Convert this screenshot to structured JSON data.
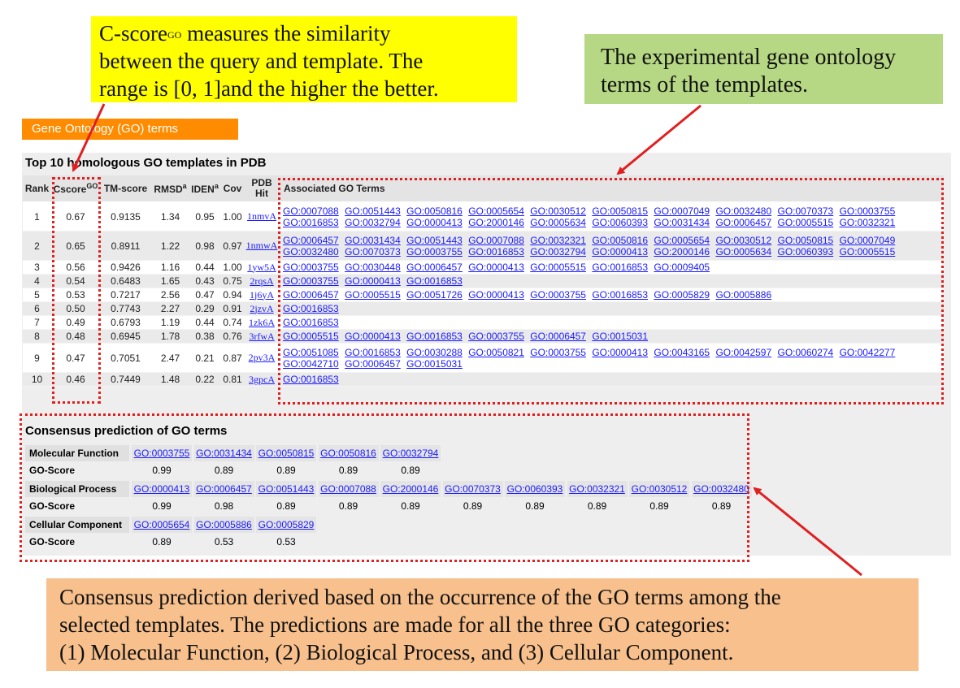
{
  "notes": {
    "cscore_line1_a": "C-score",
    "cscore_sup": "GO",
    "cscore_line1_b": " measures the similarity",
    "cscore_line2": "between the query and template. The",
    "cscore_line3": "range is [0, 1]and the  higher the better.",
    "experimental_line1": "The experimental gene ontology",
    "experimental_line2": "terms of the templates.",
    "consensus_line1": "Consensus prediction derived based on the occurrence of the GO terms  among the",
    "consensus_line2": "selected templates. The predictions are made for all the three GO categories:",
    "consensus_line3": "(1) Molecular Function, (2) Biological Process, and (3) Cellular Component."
  },
  "section_tab": "Gene Ontology (GO) terms",
  "panel_title": "Top 10 homologous GO templates in PDB",
  "table": {
    "headers": {
      "rank": "Rank",
      "cscore": "Cscore",
      "cscore_sup": "GO",
      "tmscore": "TM-score",
      "rmsd": "RMSD",
      "rmsd_sup": "a",
      "iden": "IDEN",
      "iden_sup": "a",
      "cov": "Cov",
      "pdb_hit_1": "PDB",
      "pdb_hit_2": "Hit",
      "assoc": "Associated GO Terms"
    },
    "rows": [
      {
        "rank": "1",
        "cscore": "0.67",
        "tm": "0.9135",
        "rmsd": "1.34",
        "iden": "0.95",
        "cov": "1.00",
        "pdb": "1nmvA",
        "terms": [
          "GO:0007088",
          "GO:0051443",
          "GO:0050816",
          "GO:0005654",
          "GO:0030512",
          "GO:0050815",
          "GO:0007049",
          "GO:0032480",
          "GO:0070373",
          "GO:0003755",
          "GO:0016853",
          "GO:0032794",
          "GO:0000413",
          "GO:2000146",
          "GO:0005634",
          "GO:0060393",
          "GO:0031434",
          "GO:0006457",
          "GO:0005515",
          "GO:0032321"
        ]
      },
      {
        "rank": "2",
        "cscore": "0.65",
        "tm": "0.8911",
        "rmsd": "1.22",
        "iden": "0.98",
        "cov": "0.97",
        "pdb": "1nmwA",
        "terms": [
          "GO:0006457",
          "GO:0031434",
          "GO:0051443",
          "GO:0007088",
          "GO:0032321",
          "GO:0050816",
          "GO:0005654",
          "GO:0030512",
          "GO:0050815",
          "GO:0007049",
          "GO:0032480",
          "GO:0070373",
          "GO:0003755",
          "GO:0016853",
          "GO:0032794",
          "GO:0000413",
          "GO:2000146",
          "GO:0005634",
          "GO:0060393",
          "GO:0005515"
        ]
      },
      {
        "rank": "3",
        "cscore": "0.56",
        "tm": "0.9426",
        "rmsd": "1.16",
        "iden": "0.44",
        "cov": "1.00",
        "pdb": "1yw5A",
        "terms": [
          "GO:0003755",
          "GO:0030448",
          "GO:0006457",
          "GO:0000413",
          "GO:0005515",
          "GO:0016853",
          "GO:0009405"
        ]
      },
      {
        "rank": "4",
        "cscore": "0.54",
        "tm": "0.6483",
        "rmsd": "1.65",
        "iden": "0.43",
        "cov": "0.75",
        "pdb": "2rqsA",
        "terms": [
          "GO:0003755",
          "GO:0000413",
          "GO:0016853"
        ]
      },
      {
        "rank": "5",
        "cscore": "0.53",
        "tm": "0.7217",
        "rmsd": "2.56",
        "iden": "0.47",
        "cov": "0.94",
        "pdb": "1j6yA",
        "terms": [
          "GO:0006457",
          "GO:0005515",
          "GO:0051726",
          "GO:0000413",
          "GO:0003755",
          "GO:0016853",
          "GO:0005829",
          "GO:0005886"
        ]
      },
      {
        "rank": "6",
        "cscore": "0.50",
        "tm": "0.7743",
        "rmsd": "2.27",
        "iden": "0.29",
        "cov": "0.91",
        "pdb": "2jzvA",
        "terms": [
          "GO:0016853"
        ]
      },
      {
        "rank": "7",
        "cscore": "0.49",
        "tm": "0.6793",
        "rmsd": "1.19",
        "iden": "0.44",
        "cov": "0.74",
        "pdb": "1zk6A",
        "terms": [
          "GO:0016853"
        ]
      },
      {
        "rank": "8",
        "cscore": "0.48",
        "tm": "0.6945",
        "rmsd": "1.78",
        "iden": "0.38",
        "cov": "0.76",
        "pdb": "3rfwA",
        "terms": [
          "GO:0005515",
          "GO:0000413",
          "GO:0016853",
          "GO:0003755",
          "GO:0006457",
          "GO:0015031"
        ]
      },
      {
        "rank": "9",
        "cscore": "0.47",
        "tm": "0.7051",
        "rmsd": "2.47",
        "iden": "0.21",
        "cov": "0.87",
        "pdb": "2pv3A",
        "terms": [
          "GO:0051085",
          "GO:0016853",
          "GO:0030288",
          "GO:0050821",
          "GO:0003755",
          "GO:0000413",
          "GO:0043165",
          "GO:0042597",
          "GO:0060274",
          "GO:0042277",
          "GO:0042710",
          "GO:0006457",
          "GO:0015031"
        ]
      },
      {
        "rank": "10",
        "cscore": "0.46",
        "tm": "0.7449",
        "rmsd": "1.48",
        "iden": "0.22",
        "cov": "0.81",
        "pdb": "3gpcA",
        "terms": [
          "GO:0016853"
        ]
      }
    ]
  },
  "consensus": {
    "title": "Consensus prediction of GO terms",
    "score_label": "GO-Score",
    "groups": [
      {
        "label": "Molecular Function",
        "terms": [
          "GO:0003755",
          "GO:0031434",
          "GO:0050815",
          "GO:0050816",
          "GO:0032794"
        ],
        "scores": [
          "0.99",
          "0.89",
          "0.89",
          "0.89",
          "0.89"
        ]
      },
      {
        "label": "Biological Process",
        "terms": [
          "GO:0000413",
          "GO:0006457",
          "GO:0051443",
          "GO:0007088",
          "GO:2000146",
          "GO:0070373",
          "GO:0060393",
          "GO:0032321",
          "GO:0030512",
          "GO:0032480"
        ],
        "scores": [
          "0.99",
          "0.98",
          "0.89",
          "0.89",
          "0.89",
          "0.89",
          "0.89",
          "0.89",
          "0.89",
          "0.89"
        ]
      },
      {
        "label": "Cellular Component",
        "terms": [
          "GO:0005654",
          "GO:0005886",
          "GO:0005829"
        ],
        "scores": [
          "0.89",
          "0.53",
          "0.53"
        ]
      }
    ]
  },
  "colors": {
    "annotation_red": "#e02020",
    "tab_orange": "#ff8c00",
    "link_blue": "#1a1aff"
  }
}
